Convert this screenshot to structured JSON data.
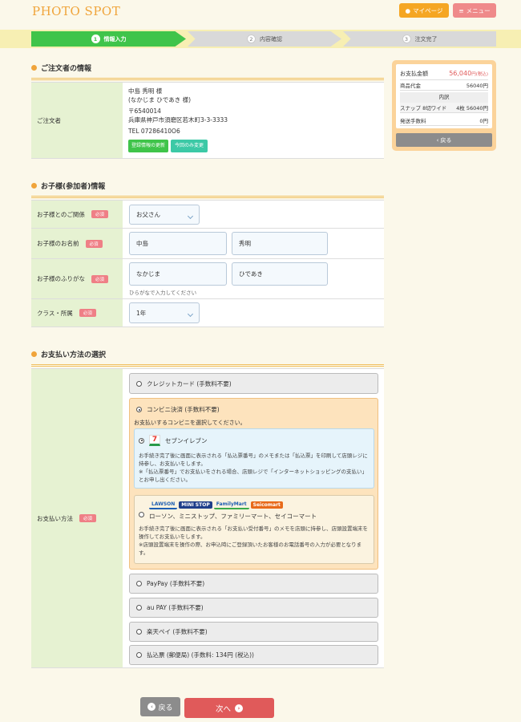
{
  "header": {
    "logo": "PHOTO SPOT",
    "mypage_label": "マイページ",
    "menu_label": "メニュー"
  },
  "steps": [
    {
      "num": "1",
      "label": "情報入力"
    },
    {
      "num": "2",
      "label": "内容確認"
    },
    {
      "num": "3",
      "label": "注文完了"
    }
  ],
  "orderer": {
    "section_title": "ご注文者の情報",
    "label": "ご注文者",
    "name": "中島 秀明 様",
    "kana": "(なかじま ひであき 様)",
    "zip": "〒6540014",
    "address": "兵庫県神戸市須磨区若木町3-3-3333",
    "tel": "TEL 07286410O6",
    "update_btn": "登録情報の更新",
    "once_btn": "今回のみ変更"
  },
  "child": {
    "section_title": "お子様(参加者)情報",
    "required": "必須",
    "relation_label": "お子様とのご関係",
    "relation_value": "お父さん",
    "name_label": "お子様のお名前",
    "last_name": "中島",
    "first_name": "秀明",
    "kana_label": "お子様のふりがな",
    "last_kana": "なかじま",
    "first_kana": "ひであき",
    "kana_hint": "ひらがなで入力してください",
    "class_label": "クラス・所属",
    "class_value": "1年"
  },
  "payment": {
    "section_title": "お支払い方法の選択",
    "label": "お支払い方法",
    "required": "必須",
    "credit": "クレジットカード (手数料不要)",
    "convenience": "コンビニ決済 (手数料不要)",
    "convenience_prompt": "お支払いするコンビニを選択してください。",
    "seven_name": "セブンイレブン",
    "seven_note1": "お手続き完了後に画面に表示される「払込票番号」のメモまたは「払込票」を印刷して店頭レジに持参し、お支払いをします。",
    "seven_note2": "※「払込票番号」でお支払いをされる場合、店頭レジで「インターネットショッピングの支払い」とお申し出ください。",
    "other_stores": "ローソン、ミニストップ、ファミリーマート、セイコーマート",
    "other_note1": "お手続き完了後に画面に表示される「お支払い受付番号」のメモを店頭に持参し、店頭設置端末を操作してお支払いをします。",
    "other_note2": "※店頭設置端末を操作の際、お申込時にご登録頂いたお客様のお電話番号の入力が必要となります。",
    "logo_lawson": "LAWSON",
    "logo_ministop": "MINI STOP",
    "logo_familymart": "FamilyMart",
    "logo_seicomart": "Seicomart",
    "paypay": "PayPay (手数料不要)",
    "aupay": "au PAY (手数料不要)",
    "rakuten": "楽天ペイ (手数料不要)",
    "postal": "払込票 (郵便局) (手数料: 134円 (税込))"
  },
  "summary": {
    "total_label": "お支払金額",
    "total_value": "56,040",
    "total_unit": "円(税込)",
    "goods_label": "商品代金",
    "goods_value": "56040円",
    "breakdown_label": "内訳",
    "item_name": "スナップ 8切ワイド",
    "item_qty": "4枚",
    "item_price": "56040円",
    "shipping_label": "発送手数料",
    "shipping_value": "0円",
    "back_label": "戻る"
  },
  "footer": {
    "back_label": "戻る",
    "next_label": "次へ"
  },
  "colors": {
    "accent": "#f0a43a",
    "step_active": "#3fc44a",
    "required": "#ef7f86",
    "next_button": "#e05a5a"
  }
}
